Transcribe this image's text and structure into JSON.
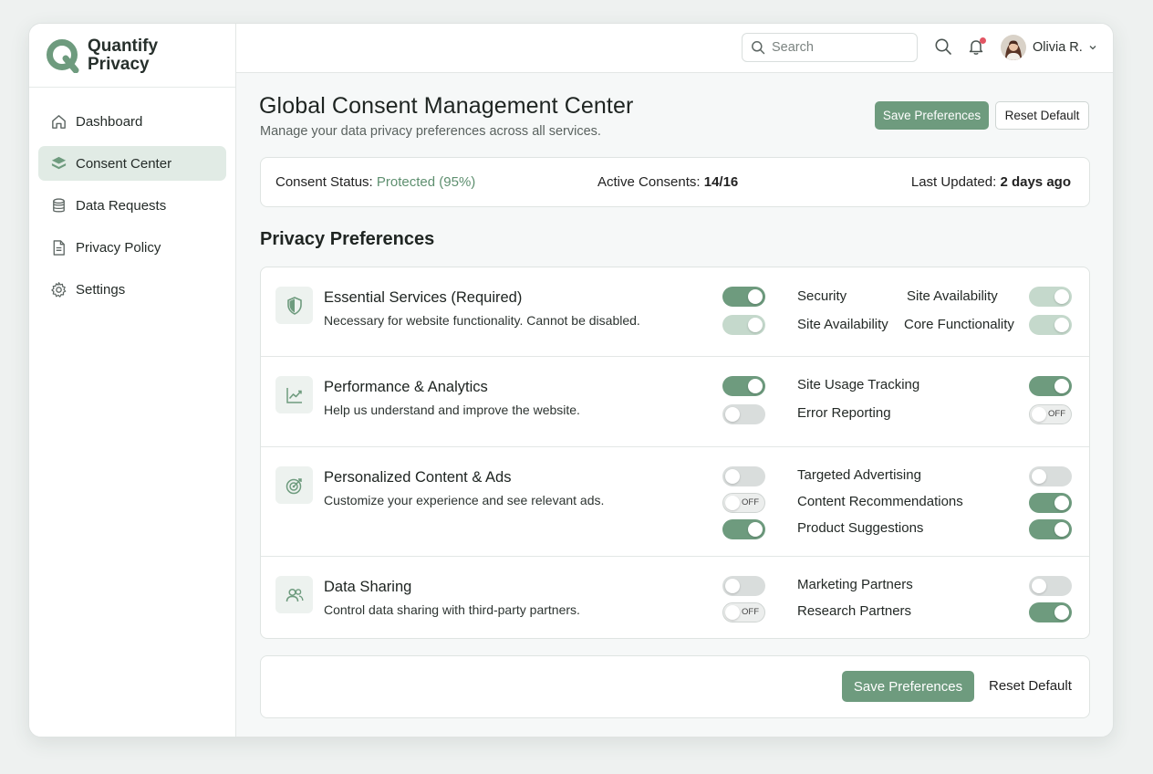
{
  "brand": {
    "line1": "Quantify",
    "line2": "Privacy",
    "color": "#6e9b7e"
  },
  "sidebar": {
    "items": [
      {
        "label": "Dashboard",
        "icon": "home-icon",
        "active": false
      },
      {
        "label": "Consent Center",
        "icon": "layers-icon",
        "active": true
      },
      {
        "label": "Data Requests",
        "icon": "database-icon",
        "active": false
      },
      {
        "label": "Privacy Policy",
        "icon": "document-icon",
        "active": false
      },
      {
        "label": "Settings",
        "icon": "gear-icon",
        "active": false
      }
    ]
  },
  "topbar": {
    "search_placeholder": "Search",
    "user_name": "Olivia R.",
    "notification_dot_color": "#e25563"
  },
  "header": {
    "title": "Global Consent Management Center",
    "subtitle": "Manage your data privacy preferences across all services.",
    "save_label": "Save Preferences",
    "reset_label": "Reset Default"
  },
  "status": {
    "consent_label": "Consent Status:",
    "consent_value": "Protected (95%)",
    "active_label": "Active Consents:",
    "active_value": "14/16",
    "updated_label": "Last Updated:",
    "updated_value": "2 days ago"
  },
  "preferences": {
    "title": "Privacy Preferences",
    "categories": [
      {
        "title": "Essential Services (Required)",
        "description": "Necessary for website functionality. Cannot be disabled.",
        "icon": "shield-icon",
        "main_toggles": [
          "on",
          "dim"
        ],
        "options": [
          {
            "label": "Security",
            "state": ""
          },
          {
            "label": "Site Availability",
            "state": "dim"
          },
          {
            "label": "Site Availability",
            "state": ""
          },
          {
            "label": "Core Functionality",
            "state": "dim"
          }
        ]
      },
      {
        "title": "Performance & Analytics",
        "description": "Help us understand and improve the website.",
        "icon": "line-chart-icon",
        "main_toggles": [
          "on",
          "off"
        ],
        "options": [
          {
            "label": "Site Usage Tracking",
            "state": "on"
          },
          {
            "label": "Error Reporting",
            "state": "offlabel"
          }
        ]
      },
      {
        "title": "Personalized Content & Ads",
        "description": "Customize your experience and see relevant ads.",
        "icon": "target-icon",
        "main_toggles": [
          "off",
          "offlabel",
          "on"
        ],
        "options": [
          {
            "label": "Targeted Advertising",
            "state": "off"
          },
          {
            "label": "Content Recommendations",
            "state": "on"
          },
          {
            "label": "Product Suggestions",
            "state": "on"
          }
        ]
      },
      {
        "title": "Data Sharing",
        "description": "Control data sharing with third-party partners.",
        "icon": "users-icon",
        "main_toggles": [
          "off",
          "offlabel"
        ],
        "options": [
          {
            "label": "Marketing Partners",
            "state": "off"
          },
          {
            "label": "Research Partners",
            "state": "on"
          }
        ]
      }
    ],
    "off_text": "OFF"
  },
  "footer": {
    "save_label": "Save Preferences",
    "reset_label": "Reset Default"
  }
}
